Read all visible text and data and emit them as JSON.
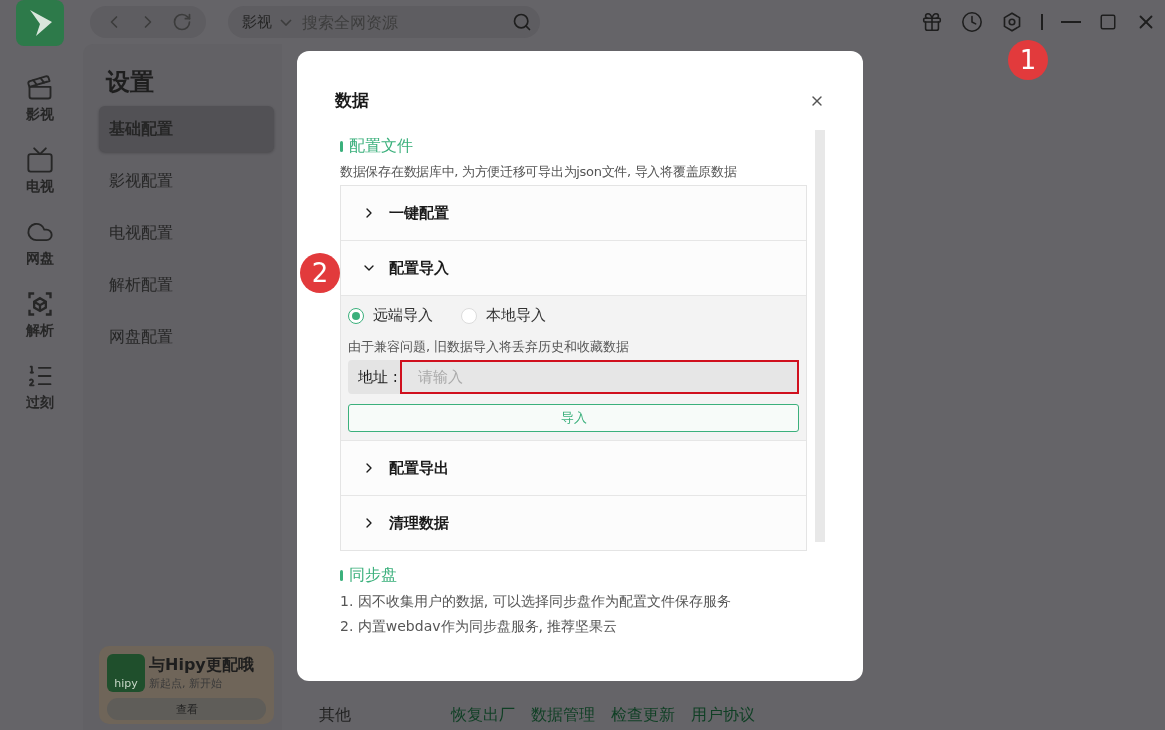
{
  "rail": {
    "items": [
      {
        "label": "影视"
      },
      {
        "label": "电视"
      },
      {
        "label": "网盘"
      },
      {
        "label": "解析"
      },
      {
        "label": "过刻"
      }
    ]
  },
  "top_bar": {
    "category": "影视",
    "search": {
      "placeholder": "搜索全网资源"
    }
  },
  "settings": {
    "title": "设置",
    "items": [
      {
        "label": "基础配置",
        "selected": true
      },
      {
        "label": "影视配置",
        "selected": false
      },
      {
        "label": "电视配置",
        "selected": false
      },
      {
        "label": "解析配置",
        "selected": false
      },
      {
        "label": "网盘配置",
        "selected": false
      }
    ]
  },
  "promo": {
    "logo_text": "hipy",
    "title": "与Hipy更配哦",
    "subtitle": "新起点, 新开始",
    "button": "查看"
  },
  "footer": {
    "label": "其他",
    "links": [
      "恢复出厂",
      "数据管理",
      "检查更新",
      "用户协议"
    ]
  },
  "dialog": {
    "title": "数据",
    "config": {
      "title": "配置文件",
      "description": "数据保存在数据库中, 为方便迁移可导出为json文件, 导入将覆盖原数据",
      "panels": [
        {
          "title": "一键配置",
          "expanded": false
        },
        {
          "title": "配置导入",
          "expanded": true,
          "options": [
            {
              "label": "远端导入",
              "selected": true
            },
            {
              "label": "本地导入",
              "selected": false
            }
          ],
          "note": "由于兼容问题, 旧数据导入将丢弃历史和收藏数据",
          "address_label": "地址 :",
          "placeholder": "请输入",
          "button": "导入"
        },
        {
          "title": "配置导出",
          "expanded": false
        },
        {
          "title": "清理数据",
          "expanded": false
        }
      ]
    },
    "sync": {
      "title": "同步盘",
      "lines": [
        "1. 因不收集用户的数据, 可以选择同步盘作为配置文件保存服务",
        "2. 内置webdav作为同步盘服务, 推荐坚果云"
      ]
    }
  },
  "markers": [
    {
      "label": "1"
    },
    {
      "label": "2"
    }
  ]
}
